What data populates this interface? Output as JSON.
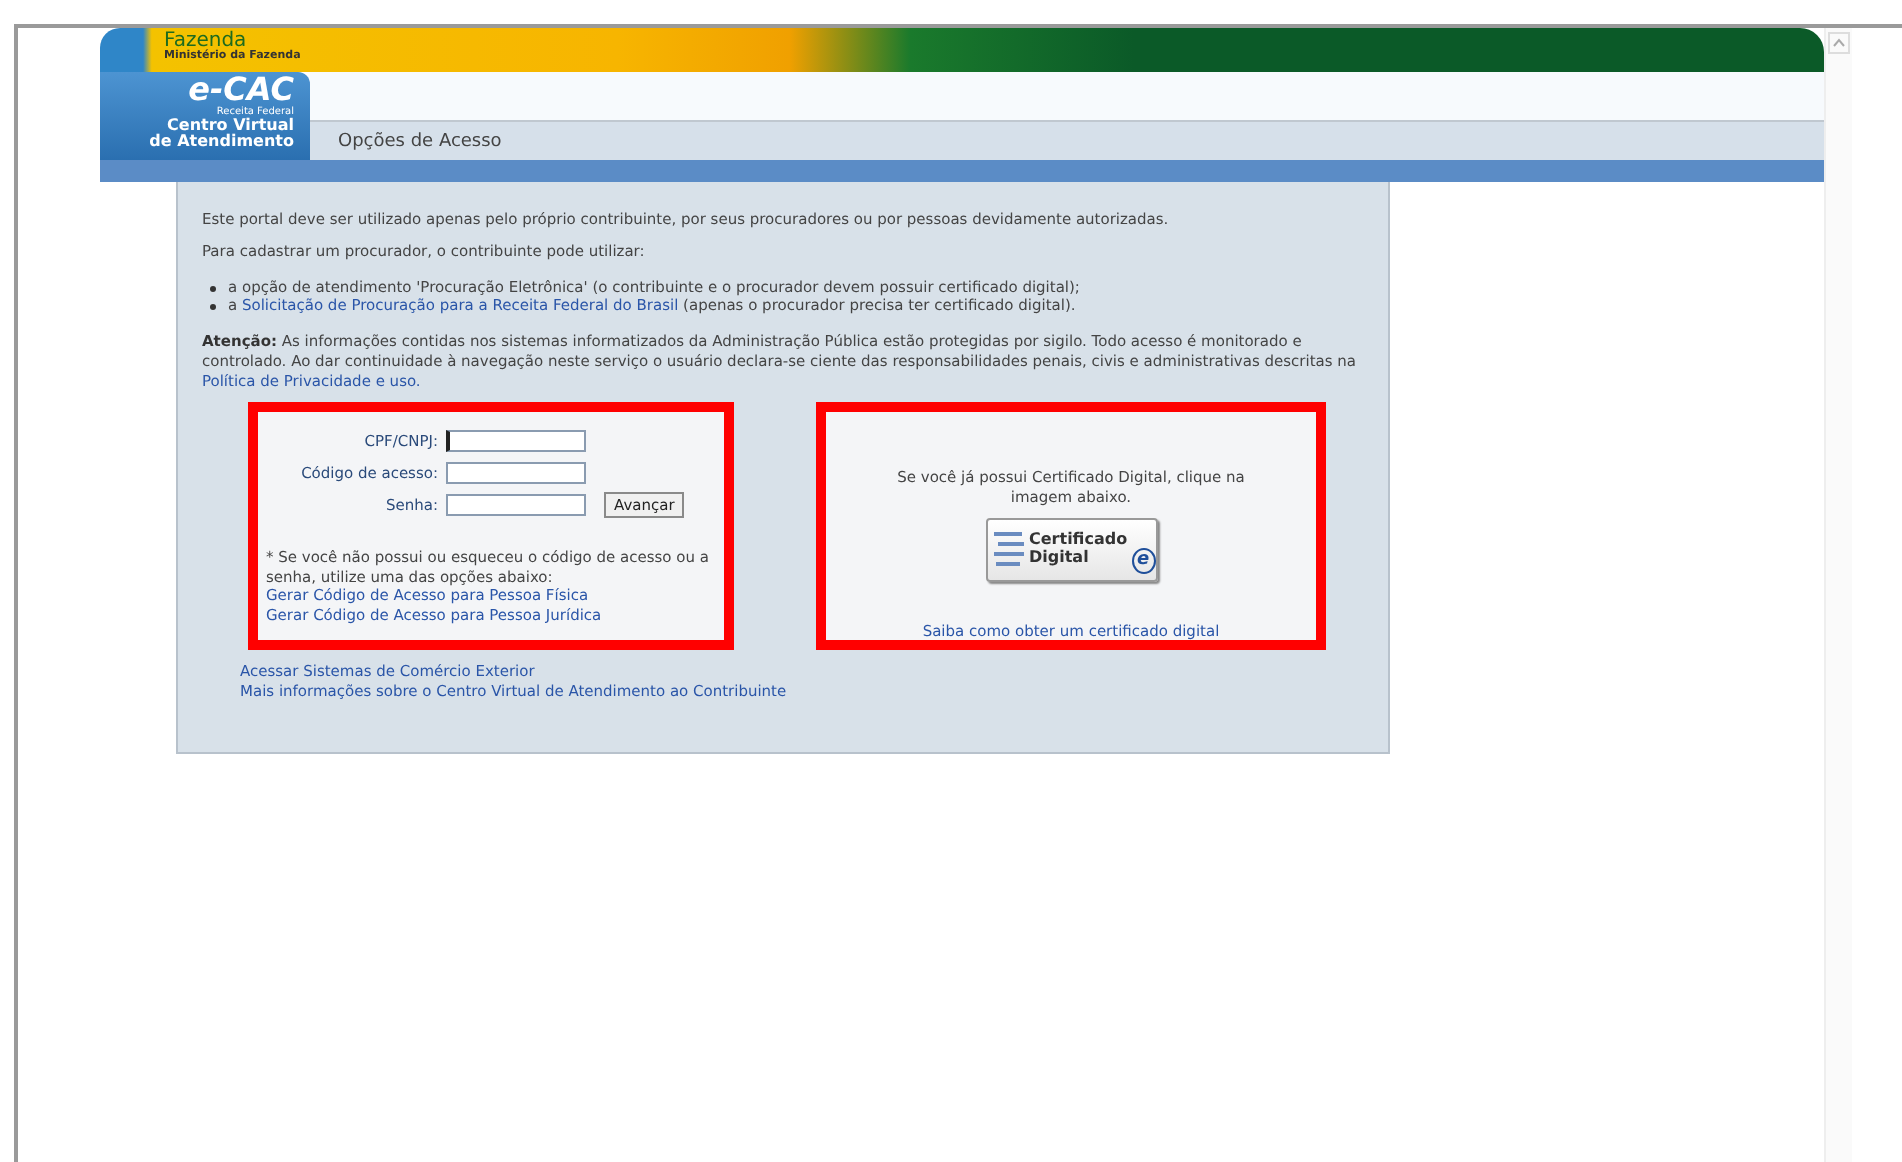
{
  "header": {
    "brand": "Fazenda",
    "ministry": "Ministério da Fazenda",
    "logo": "e-CAC",
    "logo_sub": "Receita Federal",
    "logo_title": [
      "Centro Virtual",
      "de Atendimento"
    ],
    "page_title": "Opções de Acesso"
  },
  "intro": {
    "notice": "Este portal deve ser utilizado apenas pelo próprio contribuinte, por seus procuradores ou por pessoas devidamente autorizadas.",
    "lead": "Para cadastrar um procurador, o contribuinte pode utilizar:",
    "bullets": [
      {
        "before": "a opção de atendimento 'Procuração Eletrônica' (o contribuinte e o procurador devem possuir certificado digital);"
      },
      {
        "before": "a",
        "link": "Solicitação de Procuração para a Receita Federal do Brasil",
        "after": "(apenas o procurador precisa ter certificado digital)."
      }
    ],
    "attention": {
      "label": "Atenção:",
      "text": "As informações contidas nos sistemas informatizados da Administração Pública estão protegidas por sigilo. Todo acesso é monitorado e controlado. Ao dar continuidade à navegação neste serviço o usuário declara-se ciente das responsabilidades penais, civis e administrativas descritas na",
      "link": "Política de Privacidade e uso."
    }
  },
  "login": {
    "fields": [
      {
        "label": "CPF/CNPJ:",
        "focused": true
      },
      {
        "label": "Código de acesso:",
        "focused": false
      },
      {
        "label": "Senha:",
        "focused": false
      }
    ],
    "button": "Avançar",
    "note": "* Se você não possui ou esqueceu o código de acesso ou a senha, utilize uma das opções abaixo:",
    "links": [
      "Gerar Código de Acesso para Pessoa Física",
      "Gerar Código de Acesso para Pessoa Jurídica"
    ]
  },
  "certificate": {
    "text": "Se você já possui Certificado Digital, clique na imagem abaixo.",
    "image_words": [
      "Certificado",
      "Digital"
    ],
    "image_mark": "e",
    "link": "Saiba como obter um certificado digital"
  },
  "footer_links": [
    "Acessar Sistemas de Comércio Exterior",
    "Mais informações sobre o Centro Virtual de Atendimento ao Contribuinte"
  ]
}
